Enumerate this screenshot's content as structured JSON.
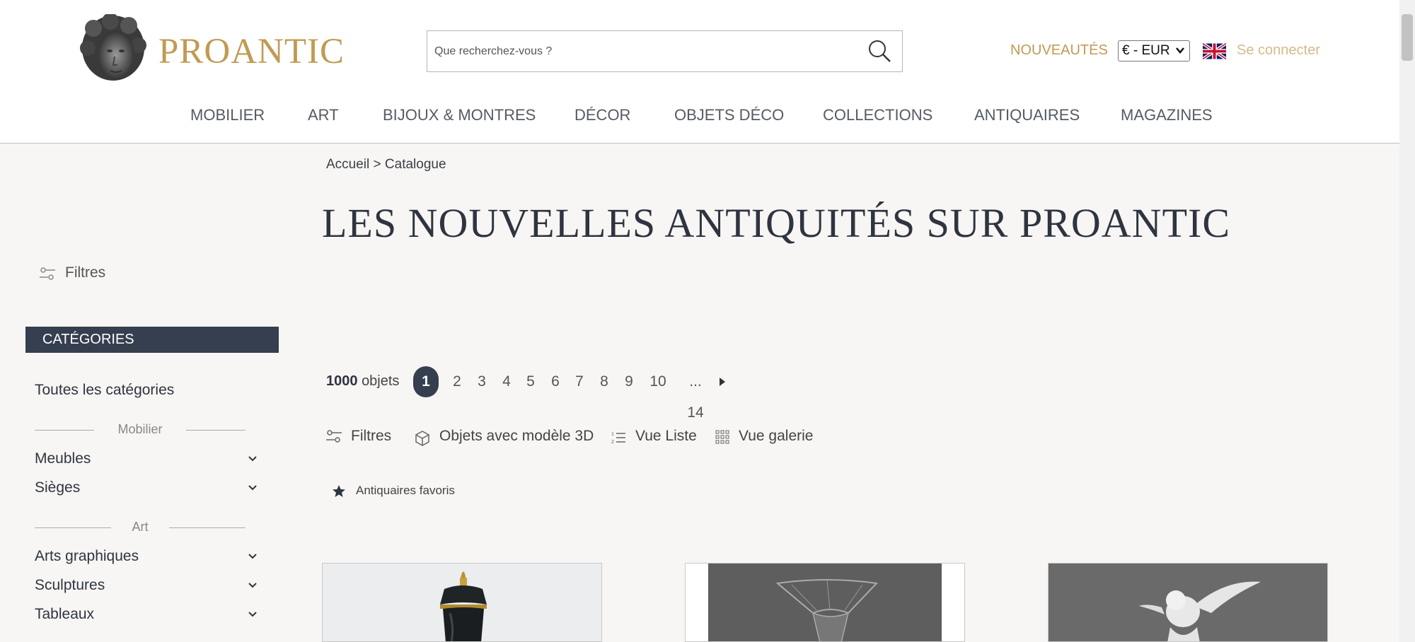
{
  "header": {
    "logo_text": "PROANTIC",
    "search_placeholder": "Que recherchez-vous ?",
    "nouveautes": "NOUVEAUTÉS",
    "currency": "€ - EUR",
    "login": "Se connecter"
  },
  "nav": [
    "MOBILIER",
    "ART",
    "BIJOUX & MONTRES",
    "DÉCOR",
    "OBJETS DÉCO",
    "COLLECTIONS",
    "ANTIQUAIRES",
    "MAGAZINES"
  ],
  "breadcrumb": "Accueil > Catalogue",
  "page_title": "LES NOUVELLES ANTIQUITÉS SUR PROANTIC",
  "sidebar": {
    "filters_label": "Filtres",
    "categories_header": "CATÉGORIES",
    "all_categories": "Toutes les catégories",
    "section_mobilier": "Mobilier",
    "meubles": "Meubles",
    "sieges": "Sièges",
    "section_art": "Art",
    "arts_graphiques": "Arts graphiques",
    "sculptures": "Sculptures",
    "tableaux": "Tableaux"
  },
  "results": {
    "count_number": "1000",
    "count_label": "objets",
    "pages": [
      "1",
      "2",
      "3",
      "4",
      "5",
      "6",
      "7",
      "8",
      "9",
      "10"
    ],
    "ellipsis_last": "... 14"
  },
  "toolbar": {
    "filters": "Filtres",
    "model3d": "Objets avec modèle 3D",
    "list_view": "Vue Liste",
    "gallery_view": "Vue galerie",
    "favorites": "Antiquaires favoris"
  },
  "colors": {
    "brand_gold": "#c19a52",
    "dark_navy": "#363f4f",
    "background": "#f7f6f4"
  }
}
